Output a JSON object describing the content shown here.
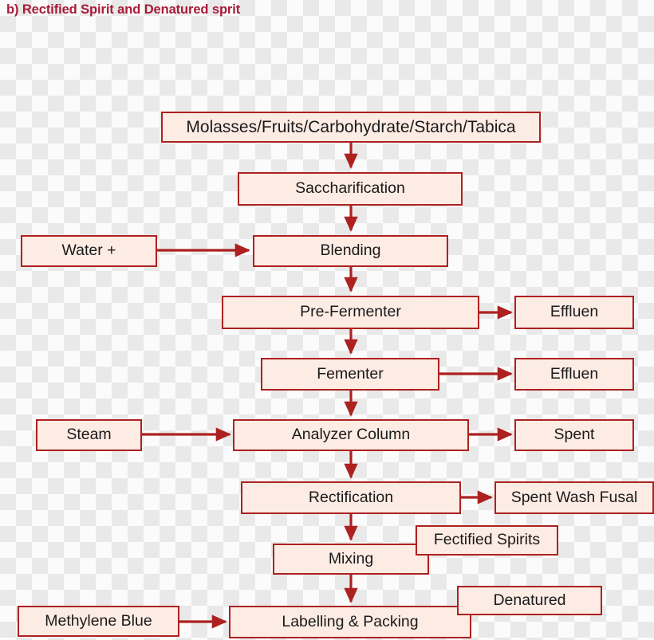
{
  "title": "b) Rectified Spirit and Denatured sprit",
  "colors": {
    "title_text": "#a81b3a",
    "box_fill": "#fdece4",
    "box_border": "#ad2121",
    "arrow": "#ad2121",
    "box_text": "#1a1a1a"
  },
  "nodes": {
    "feedstock": "Molasses/Fruits/Carbohydrate/Starch/Tabica",
    "saccharification": "Saccharification",
    "water": "Water +",
    "blending": "Blending",
    "pre_fermenter": "Pre-Fermenter",
    "effluent_1": "Effluen",
    "fermenter": "Fementer",
    "effluent_2": "Effluen",
    "steam": "Steam",
    "analyzer_column": "Analyzer Column",
    "spent": "Spent",
    "rectification": "Rectification",
    "spent_wash_fusal": "Spent Wash Fusal",
    "mixing": "Mixing",
    "rectified_spirits": "Fectified Spirits",
    "methylene_blue": "Methylene Blue",
    "labelling_packing": "Labelling & Packing",
    "denatured": "Denatured"
  },
  "flow": {
    "main_sequence": [
      "Molasses/Fruits/Carbohydrate/Starch/Tabica",
      "Saccharification",
      "Blending",
      "Pre-Fermenter",
      "Fementer",
      "Analyzer Column",
      "Rectification",
      "Mixing",
      "Labelling & Packing"
    ],
    "inputs": [
      {
        "from": "Water +",
        "to": "Blending"
      },
      {
        "from": "Steam",
        "to": "Analyzer Column"
      },
      {
        "from": "Methylene Blue",
        "to": "Labelling & Packing"
      }
    ],
    "outputs": [
      {
        "from": "Pre-Fermenter",
        "to": "Effluen"
      },
      {
        "from": "Fementer",
        "to": "Effluen"
      },
      {
        "from": "Analyzer Column",
        "to": "Spent"
      },
      {
        "from": "Rectification",
        "to": "Spent Wash Fusal"
      }
    ],
    "attached_labels": [
      {
        "near": "Mixing",
        "label": "Fectified Spirits"
      },
      {
        "near": "Labelling & Packing",
        "label": "Denatured"
      }
    ]
  }
}
